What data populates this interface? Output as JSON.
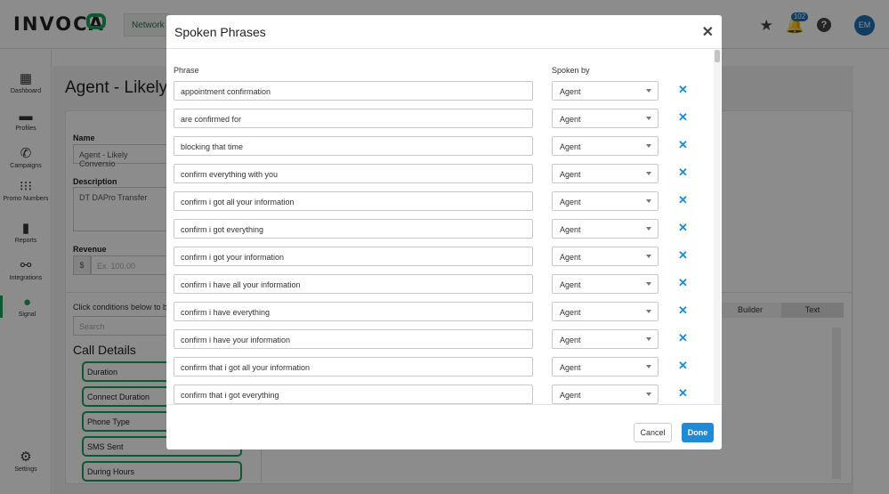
{
  "topbar": {
    "logo_text": "INVOCA",
    "network_tab": "Network",
    "notification_count": "102",
    "avatar_initials": "EM",
    "icons": [
      "star-icon",
      "bell-icon",
      "help-icon"
    ]
  },
  "sidebar": {
    "items": [
      {
        "label": "Dashboard",
        "icon": "dashboard-icon"
      },
      {
        "label": "Profiles",
        "icon": "profiles-icon"
      },
      {
        "label": "Campaigns",
        "icon": "campaigns-icon"
      },
      {
        "label": "Promo Numbers",
        "icon": "promo-numbers-icon"
      },
      {
        "label": "Reports",
        "icon": "reports-icon"
      },
      {
        "label": "Integrations",
        "icon": "integrations-icon"
      },
      {
        "label": "Signal",
        "icon": "signal-icon",
        "active": true
      },
      {
        "label": "Settings",
        "icon": "settings-icon"
      }
    ]
  },
  "page": {
    "title": "Agent - Likely C",
    "name_label": "Name",
    "name_value": "Agent - Likely Conversio",
    "description_label": "Description",
    "description_value": "DT DAPro Transfer",
    "revenue_label": "Revenue",
    "revenue_prefix": "$",
    "revenue_placeholder": "Ex. 100.00",
    "conditions_hint": "Click conditions below to b",
    "search_placeholder": "Search",
    "call_details_heading": "Call Details",
    "conditions": [
      "Duration",
      "Connect Duration",
      "Phone Type",
      "SMS Sent",
      "During Hours"
    ],
    "view_toggle": [
      "Builder",
      "Text"
    ]
  },
  "modal": {
    "title": "Spoken Phrases",
    "col_phrase": "Phrase",
    "col_spoken_by": "Spoken by",
    "rows": [
      {
        "phrase": "appointment confirmation",
        "spoken_by": "Agent"
      },
      {
        "phrase": "are confirmed for",
        "spoken_by": "Agent"
      },
      {
        "phrase": "blocking that time",
        "spoken_by": "Agent"
      },
      {
        "phrase": "confirm everything with you",
        "spoken_by": "Agent"
      },
      {
        "phrase": "confirm i got all your information",
        "spoken_by": "Agent"
      },
      {
        "phrase": "confirm i got everything",
        "spoken_by": "Agent"
      },
      {
        "phrase": "confirm i got your information",
        "spoken_by": "Agent"
      },
      {
        "phrase": "confirm i have all your information",
        "spoken_by": "Agent"
      },
      {
        "phrase": "confirm i have everything",
        "spoken_by": "Agent"
      },
      {
        "phrase": "confirm i have your information",
        "spoken_by": "Agent"
      },
      {
        "phrase": "confirm that i got all your information",
        "spoken_by": "Agent"
      },
      {
        "phrase": "confirm that i got everything",
        "spoken_by": "Agent"
      },
      {
        "phrase": "",
        "spoken_by": ""
      }
    ],
    "cancel_label": "Cancel",
    "done_label": "Done"
  },
  "colors": {
    "accent_blue": "#1f8bd6",
    "brand_green": "#1aa35b"
  }
}
